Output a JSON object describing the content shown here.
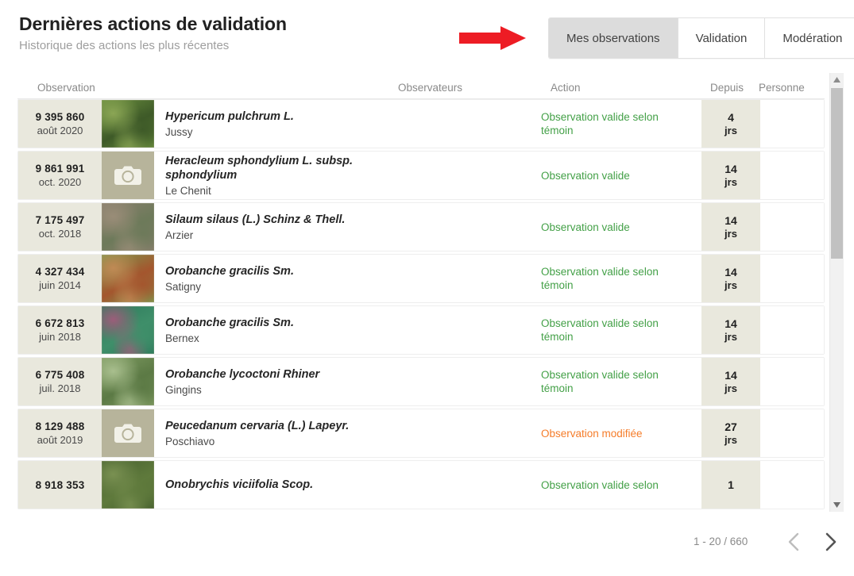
{
  "header": {
    "title": "Dernières actions de validation",
    "subtitle": "Historique des actions les plus récentes"
  },
  "tabs": [
    {
      "label": "Mes observations",
      "active": true
    },
    {
      "label": "Validation",
      "active": false
    },
    {
      "label": "Modération",
      "active": false
    }
  ],
  "annotation": {
    "type": "red-arrow",
    "color": "#ed1c24",
    "points_to": "Mes observations"
  },
  "columns": {
    "observation": "Observation",
    "observateurs": "Observateurs",
    "action": "Action",
    "depuis": "Depuis",
    "personne": "Personne"
  },
  "colors": {
    "action_valid": "#43a047",
    "action_modified": "#f57c29",
    "cell_highlight": "#e9e8dd",
    "tab_active": "#dcdcdc"
  },
  "rows": [
    {
      "id": "9 395 860",
      "date": "août 2020",
      "species": "Hypericum pulchrum L.",
      "place": "Jussy",
      "thumb": "photo",
      "thumb_colors": [
        "#6b8f3e",
        "#3e5a28",
        "#8ba655"
      ],
      "observers": "",
      "action": "Observation valide selon témoin",
      "action_type": "valid",
      "depuis_num": "4",
      "depuis_unit": "jrs",
      "personne": ""
    },
    {
      "id": "9 861 991",
      "date": "oct. 2020",
      "species": "Heracleum sphondylium L. subsp. sphondylium",
      "place": "Le Chenit",
      "thumb": "camera",
      "thumb_colors": [
        "#b7b49b",
        "#b7b49b",
        "#b7b49b"
      ],
      "observers": "",
      "action": "Observation valide",
      "action_type": "valid",
      "depuis_num": "14",
      "depuis_unit": "jrs",
      "personne": ""
    },
    {
      "id": "7 175 497",
      "date": "oct. 2018",
      "species": "Silaum silaus (L.) Schinz & Thell.",
      "place": "Arzier",
      "thumb": "photo",
      "thumb_colors": [
        "#8a7f6e",
        "#6d7a5a",
        "#9a8d78"
      ],
      "observers": "",
      "action": "Observation valide",
      "action_type": "valid",
      "depuis_num": "14",
      "depuis_unit": "jrs",
      "personne": ""
    },
    {
      "id": "4 327 434",
      "date": "juin 2014",
      "species": "Orobanche gracilis Sm.",
      "place": "Satigny",
      "thumb": "photo",
      "thumb_colors": [
        "#7d9a4e",
        "#a4562e",
        "#c08a55"
      ],
      "observers": "",
      "action": "Observation valide selon témoin",
      "action_type": "valid",
      "depuis_num": "14",
      "depuis_unit": "jrs",
      "personne": ""
    },
    {
      "id": "6 672 813",
      "date": "juin 2018",
      "species": "Orobanche gracilis Sm.",
      "place": "Bernex",
      "thumb": "photo",
      "thumb_colors": [
        "#2e7a5c",
        "#3f8f6a",
        "#9c5d7a"
      ],
      "observers": "",
      "action": "Observation valide selon témoin",
      "action_type": "valid",
      "depuis_num": "14",
      "depuis_unit": "jrs",
      "personne": ""
    },
    {
      "id": "6 775 408",
      "date": "juil. 2018",
      "species": "Orobanche lycoctoni Rhiner",
      "place": "Gingins",
      "thumb": "photo",
      "thumb_colors": [
        "#7f9b62",
        "#5c7a45",
        "#a9bf8e"
      ],
      "observers": "",
      "action": "Observation valide selon témoin",
      "action_type": "valid",
      "depuis_num": "14",
      "depuis_unit": "jrs",
      "personne": ""
    },
    {
      "id": "8 129 488",
      "date": "août 2019",
      "species": "Peucedanum cervaria (L.) Lapeyr.",
      "place": "Poschiavo",
      "thumb": "camera",
      "thumb_colors": [
        "#b7b49b",
        "#b7b49b",
        "#b7b49b"
      ],
      "observers": "",
      "action": "Observation modifiée",
      "action_type": "modified",
      "depuis_num": "27",
      "depuis_unit": "jrs",
      "personne": ""
    },
    {
      "id": "8 918 353",
      "date": "",
      "species": "Onobrychis viciifolia Scop.",
      "place": "",
      "thumb": "photo",
      "thumb_colors": [
        "#47612f",
        "#5f7a3c",
        "#7a9152"
      ],
      "observers": "",
      "action": "Observation valide selon",
      "action_type": "valid",
      "depuis_num": "1",
      "depuis_unit": "",
      "personne": ""
    }
  ],
  "pagination": {
    "range": "1 - 20 / 660",
    "prev_label": "‹",
    "next_label": "›"
  },
  "scrollbar": {
    "up_label": "▲",
    "down_label": "▼"
  }
}
